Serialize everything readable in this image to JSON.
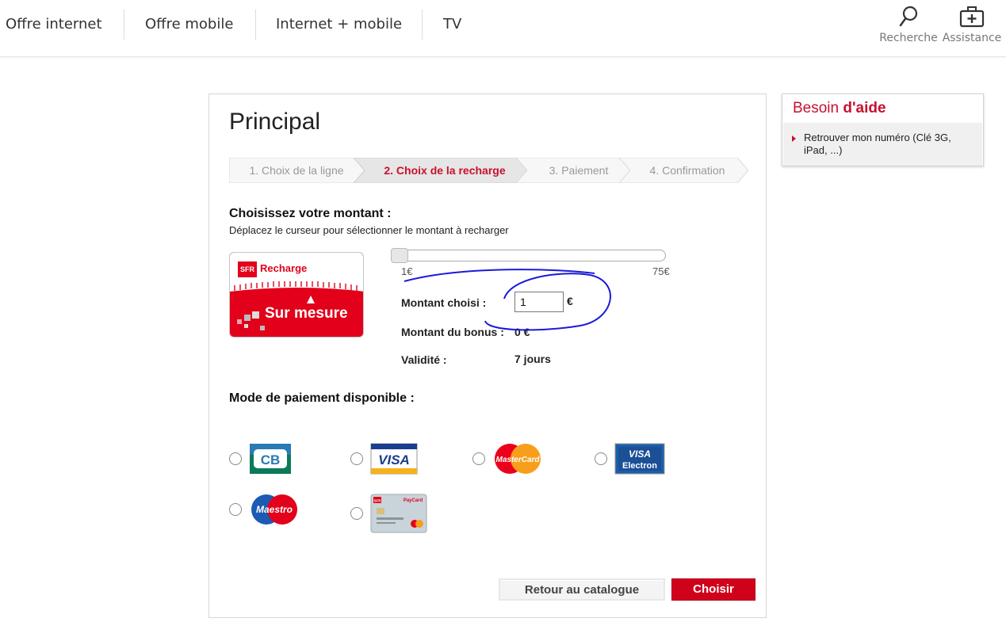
{
  "nav": {
    "items": [
      "Offre internet",
      "Offre mobile",
      "Internet + mobile",
      "TV"
    ],
    "search_label": "Recherche",
    "assistance_label": "Assistance"
  },
  "main": {
    "title": "Principal",
    "steps": [
      "1. Choix de la ligne",
      "2. Choix de la recharge",
      "3. Paiement",
      "4. Confirmation"
    ],
    "active_step": 1,
    "choose_heading": "Choisissez votre montant :",
    "choose_sub": "Déplacez le curseur pour sélectionner le montant à recharger",
    "card": {
      "brand": "SFR",
      "title": "Recharge",
      "subtitle": "Sur mesure"
    },
    "slider": {
      "min_label": "1€",
      "max_label": "75€",
      "min": 1,
      "max": 75,
      "value": 1
    },
    "amount_label": "Montant choisi :",
    "amount_value": "1",
    "currency": "€",
    "bonus_label": "Montant du bonus :",
    "bonus_value": "0 €",
    "validity_label": "Validité :",
    "validity_value": "7 jours",
    "payment_heading": "Mode de paiement disponible :",
    "payment_methods": [
      {
        "id": "cb",
        "label": "CB"
      },
      {
        "id": "visa",
        "label": "VISA"
      },
      {
        "id": "mastercard",
        "label": "MasterCard"
      },
      {
        "id": "visa-electron",
        "label": "VISA",
        "label2": "Electron"
      },
      {
        "id": "maestro",
        "label": "Maestro"
      },
      {
        "id": "sfr-card",
        "label": "SFR",
        "label2": "PayCard"
      }
    ],
    "back_button": "Retour au catalogue",
    "choose_button": "Choisir"
  },
  "help": {
    "title_normal": "Besoin",
    "title_bold": "d'aide",
    "link": "Retrouver mon numéro (Clé 3G, iPad, ...)"
  },
  "colors": {
    "accent": "#c8102e",
    "sfr_red": "#e2001a",
    "annotation": "#1a1adb"
  }
}
